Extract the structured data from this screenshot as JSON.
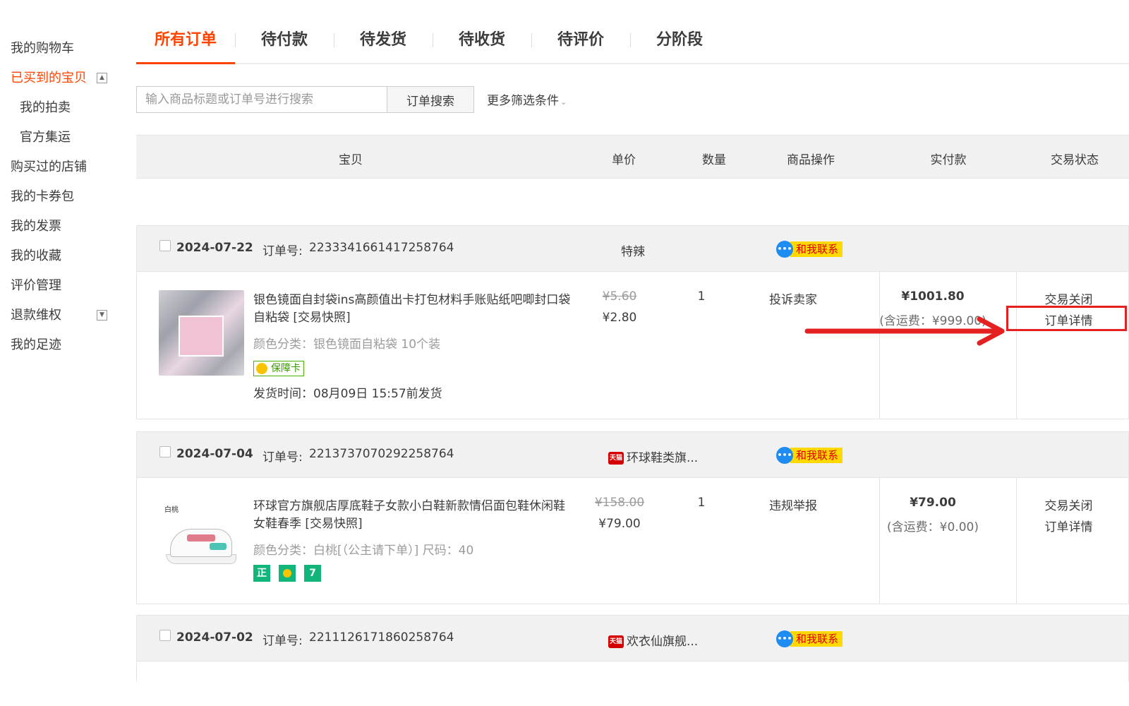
{
  "sidebar": {
    "items": [
      {
        "label": "我的购物车"
      },
      {
        "label": "已买到的宝贝",
        "toggle": "▲"
      },
      {
        "label": "我的拍卖"
      },
      {
        "label": "官方集运"
      },
      {
        "label": "购买过的店铺"
      },
      {
        "label": "我的卡券包"
      },
      {
        "label": "我的发票"
      },
      {
        "label": "我的收藏"
      },
      {
        "label": "评价管理"
      },
      {
        "label": "退款维权",
        "toggle": "▼"
      },
      {
        "label": "我的足迹"
      }
    ]
  },
  "tabs": [
    "所有订单",
    "待付款",
    "待发货",
    "待收货",
    "待评价",
    "分阶段"
  ],
  "search": {
    "placeholder": "输入商品标题或订单号进行搜索",
    "button": "订单搜索",
    "more_filters": "更多筛选条件",
    "more_filters_icon": "chevron-down-icon"
  },
  "columns": [
    "宝贝",
    "单价",
    "数量",
    "商品操作",
    "实付款",
    "交易状态"
  ],
  "orders": [
    {
      "date": "2024-07-22",
      "order_no_label": "订单号:",
      "order_no": "2233341661417258764",
      "shop": "特辣",
      "contact": "和我联系",
      "title": "银色镜面自封袋ins高颜值出卡打包材料手账贴纸吧唧封口袋自粘袋 [交易快照]",
      "attr": "颜色分类：银色镜面自粘袋 10个装",
      "badge": "保障卡",
      "ship_time": "发货时间：08月09日 15:57前发货",
      "orig_price": "¥5.60",
      "price": "¥2.80",
      "qty": "1",
      "op": "投诉卖家",
      "paid": "¥1001.80",
      "fee": "(含运费：¥999.00)",
      "status": "交易关闭",
      "detail": "订单详情"
    },
    {
      "date": "2024-07-04",
      "order_no_label": "订单号:",
      "order_no": "2213737070292258764",
      "shop": "环球鞋类旗...",
      "shop_icon": "天猫",
      "contact": "和我联系",
      "title": "环球官方旗舰店厚底鞋子女款小白鞋新款情侣面包鞋休闲鞋女鞋春季 [交易快照]",
      "attr": "颜色分类：白桃[（公主请下单）] 尺码：40",
      "thumb_label": "白桃",
      "badges": [
        "正",
        "",
        "7"
      ],
      "orig_price": "¥158.00",
      "price": "¥79.00",
      "qty": "1",
      "op": "违规举报",
      "paid": "¥79.00",
      "fee": "(含运费：¥0.00)",
      "status": "交易关闭",
      "detail": "订单详情"
    },
    {
      "date": "2024-07-02",
      "order_no_label": "订单号:",
      "order_no": "2211126171860258764",
      "shop": "欢衣仙旗舰...",
      "shop_icon": "天猫",
      "contact": "和我联系"
    }
  ],
  "colors": {
    "accent": "#ff4400",
    "header_bg": "#f1f1f1",
    "annotation_red": "#e42020",
    "contact_yellow": "#ffd900",
    "contact_blue": "#1e8df1",
    "badge_green": "#13b67a"
  }
}
